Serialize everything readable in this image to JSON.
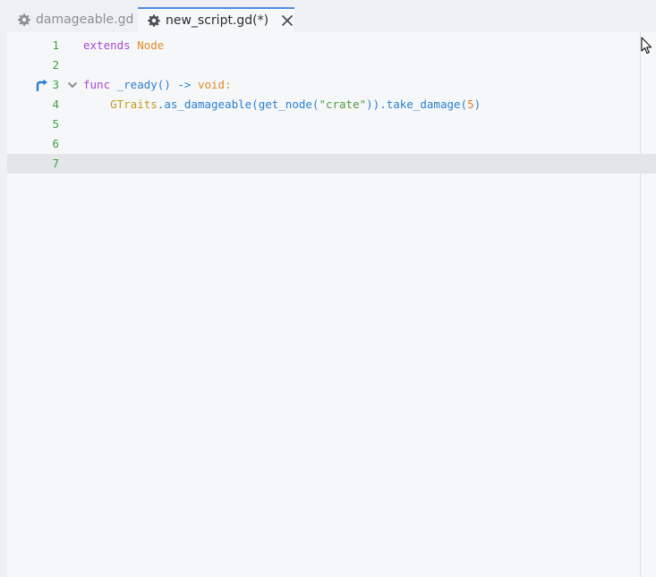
{
  "tabs": [
    {
      "label": "damageable.gd",
      "icon": "gear-icon",
      "active": false
    },
    {
      "label": "new_script.gd(*)",
      "icon": "gear-icon",
      "active": true,
      "close_icon": "close-icon"
    }
  ],
  "editor": {
    "current_line": 7,
    "lines": [
      {
        "number": "1",
        "tokens": [
          "extends",
          " ",
          "Node"
        ]
      },
      {
        "number": "2",
        "tokens": []
      },
      {
        "number": "3",
        "tokens": [
          "func",
          " _ready",
          "()",
          " -> ",
          "void",
          ":"
        ],
        "gutter_icon": "bookmark-arrow-icon",
        "fold_icon": "chevron-down-icon"
      },
      {
        "number": "4",
        "tokens": [
          "    ",
          "GTraits",
          ".",
          "as_damageable",
          "(",
          "get_node",
          "(",
          "\"crate\"",
          "))",
          ".",
          "take_damage",
          "(",
          "5",
          ")"
        ]
      },
      {
        "number": "5",
        "tokens": []
      },
      {
        "number": "6",
        "tokens": []
      },
      {
        "number": "7",
        "tokens": []
      }
    ]
  },
  "colors": {
    "accent": "#4a8fe0",
    "line_number": "#3fa13c",
    "keyword": "#a74ad2",
    "type": "#de8d2a",
    "function": "#2a80d0",
    "class": "#c89a1b",
    "string": "#4e9a3e"
  }
}
